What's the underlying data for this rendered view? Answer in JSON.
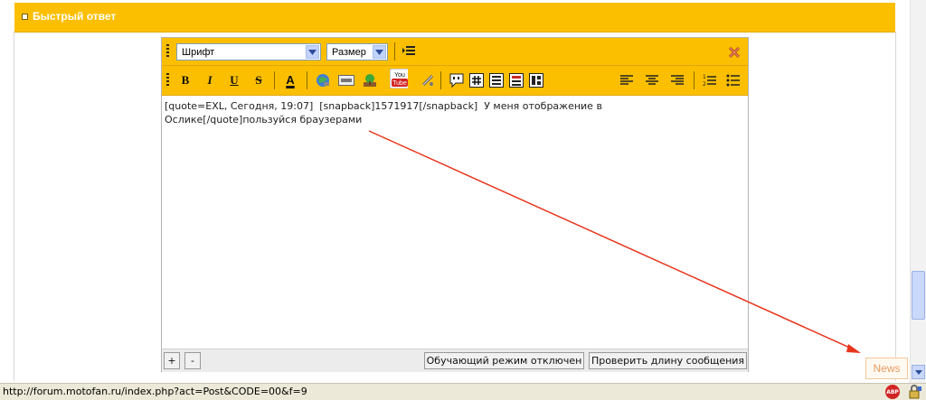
{
  "header": {
    "title": "Быстрый ответ"
  },
  "toolbar": {
    "font_select": "Шрифт",
    "size_select": "Размер",
    "bold": "B",
    "italic": "I",
    "underline": "U",
    "strike": "S",
    "font_color": "A"
  },
  "editor": {
    "text": "[quote=EXL, Сегодня, 19:07]  [snapback]1571917[/snapback]  У меня отображение в\nОслике[/quote]пользуйся браузерами"
  },
  "footer": {
    "increase": "+",
    "decrease": "-",
    "tutorial_mode": "Обучающий режим отключен",
    "check_length": "Проверить длину сообщения"
  },
  "news_button": "News",
  "statusbar": {
    "url": "http://forum.motofan.ru/index.php?act=Post&CODE=00&f=9"
  },
  "icons": {
    "abp": "ABP",
    "youtube_top": "You",
    "youtube_bottom": "Tube"
  },
  "colors": {
    "toolbar": "#fbbf00",
    "arrow": "#e8351c",
    "status_bar": "#ece9d8"
  }
}
